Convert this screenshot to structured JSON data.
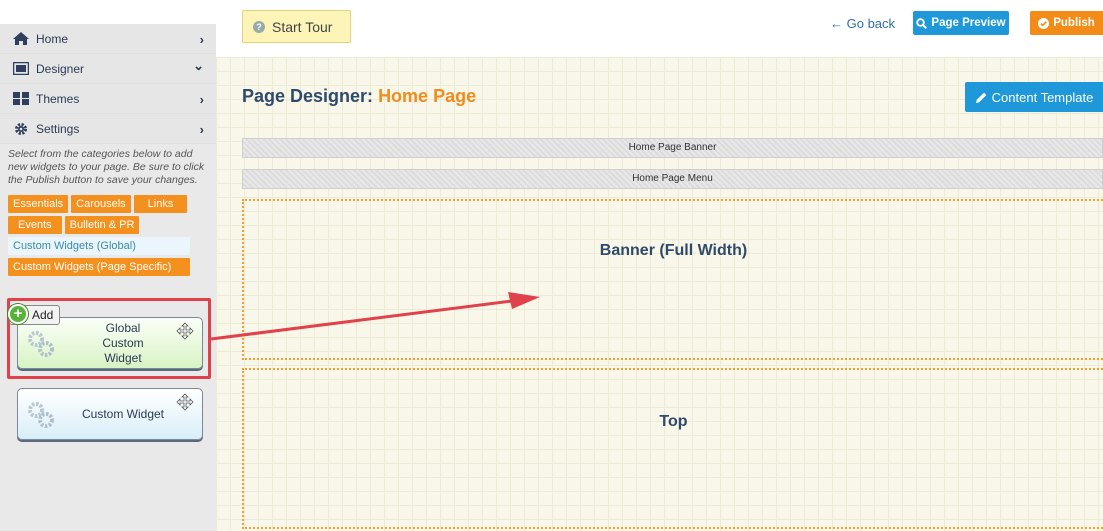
{
  "sidebar": {
    "nav": [
      {
        "label": "Home",
        "icon": "home-icon",
        "chevron": "›"
      },
      {
        "label": "Designer",
        "icon": "designer-icon",
        "chevron": "⌄"
      },
      {
        "label": "Themes",
        "icon": "themes-grid-icon",
        "chevron": "›"
      },
      {
        "label": "Settings",
        "icon": "gear-icon",
        "chevron": "›"
      }
    ],
    "help_text": "Select from the categories below to add new widgets to your page. Be sure to click the Publish button to save your changes.",
    "categories": [
      {
        "label": "Essentials",
        "selected": false
      },
      {
        "label": "Carousels",
        "selected": false
      },
      {
        "label": "Links",
        "selected": false
      },
      {
        "label": "Events",
        "selected": false
      },
      {
        "label": "Bulletin & PR",
        "selected": false
      },
      {
        "label": "Custom Widgets (Global)",
        "selected": true
      },
      {
        "label": "Custom Widgets (Page Specific)",
        "selected": false
      }
    ],
    "add_badge": "Add",
    "widgets": [
      {
        "label": "Global Custom Widget"
      },
      {
        "label": "Custom Widget"
      }
    ]
  },
  "topbar": {
    "start_tour": "Start Tour",
    "go_back": "← Go back",
    "preview": "Page Preview",
    "publish": "Publish"
  },
  "designer": {
    "title_prefix": "Page Designer:",
    "title_page": "Home Page",
    "content_template": "Content Template",
    "bars": [
      "Home Page Banner",
      "Home Page Menu"
    ],
    "zones": [
      "Banner (Full Width)",
      "Top"
    ]
  },
  "colors": {
    "accent_orange": "#f28b17",
    "accent_blue": "#1e98d8",
    "highlight_red": "#e0414a",
    "title_navy": "#2f4b6b"
  }
}
